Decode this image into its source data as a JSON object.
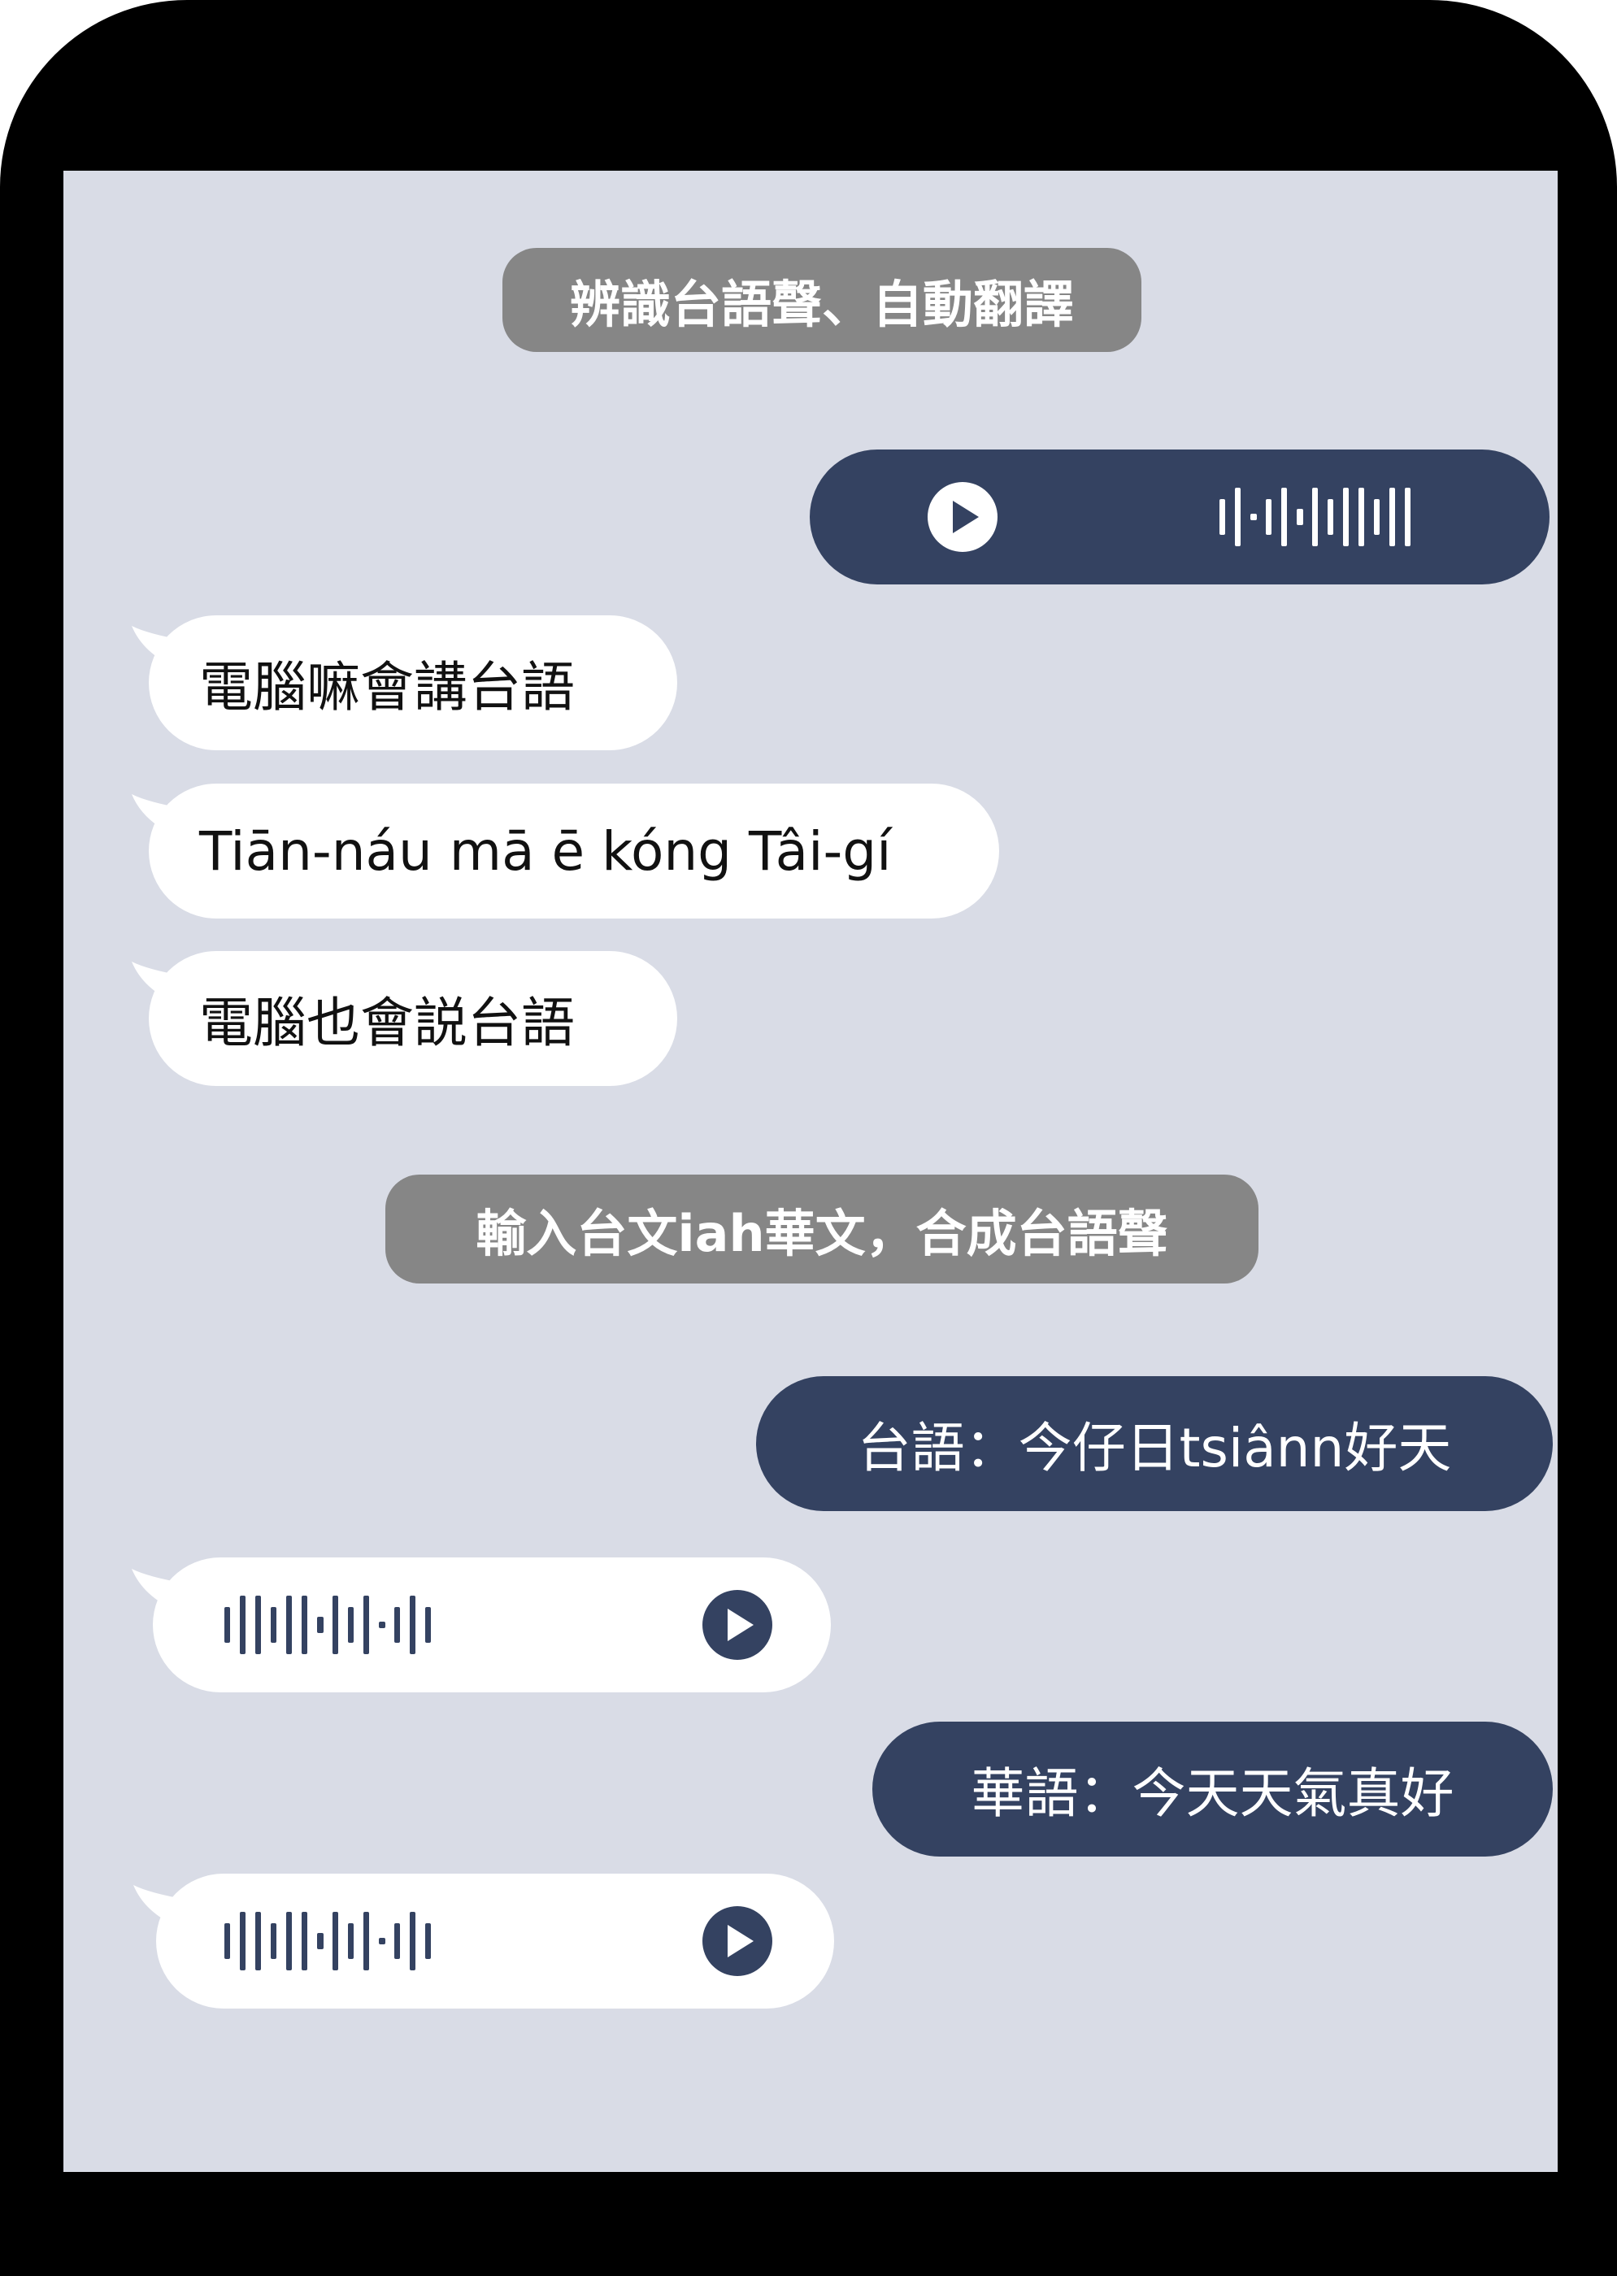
{
  "colors": {
    "frame": "#000000",
    "screen_background": "#d9dce6",
    "label_background": "#868686",
    "outgoing_bubble": "#344261",
    "incoming_bubble": "#ffffff",
    "incoming_text": "#111111",
    "outgoing_text": "#ffffff"
  },
  "section1": {
    "label": "辨識台語聲、自動翻譯",
    "voice_message": {
      "icons": [
        "play-icon",
        "waveform-icon"
      ]
    },
    "replies": [
      "電腦嘛會講台語",
      "Tiān-náu mā ē kóng Tâi-gí",
      "電腦也會説台語"
    ]
  },
  "section2": {
    "label": "輸入台文iah華文，合成台語聲",
    "messages": [
      {
        "text": "台語：今仔日tsiânn好天",
        "reply_icons": [
          "waveform-icon",
          "play-icon"
        ]
      },
      {
        "text": "華語：今天天氣真好",
        "reply_icons": [
          "waveform-icon",
          "play-icon"
        ]
      }
    ]
  }
}
